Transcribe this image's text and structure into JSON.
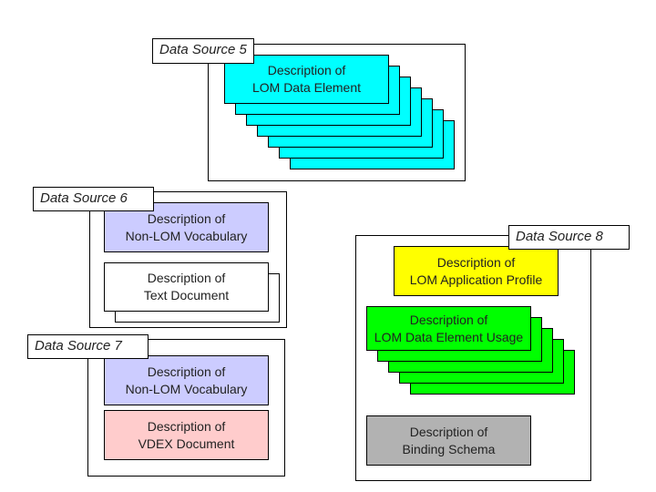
{
  "colors": {
    "lom_element": "#00ffff",
    "app_profile": "#ffff00",
    "element_usage": "#00ff00",
    "binding": "#b2b2b2",
    "vocabulary": "#ccccff",
    "vdex": "#ffcccc",
    "text_doc": "#ffffff"
  },
  "ds5": {
    "label": "Data Source 5",
    "item": {
      "line1": "Description of",
      "line2": "LOM Data Element"
    }
  },
  "ds6": {
    "label": "Data Source 6",
    "vocab": {
      "line1": "Description of",
      "line2": "Non-LOM Vocabulary"
    },
    "text": {
      "line1": "Description of",
      "line2": "Text Document"
    }
  },
  "ds7": {
    "label": "Data Source 7",
    "vocab": {
      "line1": "Description of",
      "line2": "Non-LOM Vocabulary"
    },
    "vdex": {
      "line1": "Description of",
      "line2": "VDEX Document"
    }
  },
  "ds8": {
    "label": "Data Source 8",
    "profile": {
      "line1": "Description of",
      "line2": "LOM Application Profile"
    },
    "usage": {
      "line1": "Description of",
      "line2": "LOM Data Element Usage"
    },
    "binding": {
      "line1": "Description of",
      "line2": "Binding Schema"
    }
  }
}
